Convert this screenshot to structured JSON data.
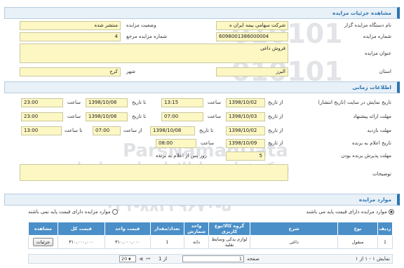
{
  "header": {
    "title": "مشاهده جزئیات مزایده"
  },
  "auction": {
    "org_label": "نام دستگاه مزایده گزار",
    "org_value": "شرکت سهامی بیمه ایران ه",
    "status_label": "وضعیت مزایده",
    "status_value": "منتشر شده",
    "number_label": "شماره مزایده",
    "number_value": "6098001386000004",
    "ref_label": "شماره مزایده مرجع",
    "ref_value": "4",
    "subject_label": "عنوان مزایده",
    "subject_value": "فروش داغی",
    "province_label": "استان",
    "province_value": "البرز",
    "city_label": "شهر",
    "city_value": "کرج"
  },
  "timing": {
    "title": "اطلاعات زمانی",
    "display": {
      "label": "تاریخ نمایش در سایت (تاریخ انتشار)",
      "from_label": "از تاریخ",
      "from_date": "1398/10/02",
      "time_label": "ساعت",
      "from_time": "13:15",
      "to_label": "تا تاریخ",
      "to_date": "1398/10/08",
      "to_time": "23:00"
    },
    "offer": {
      "label": "مهلت ارائه پیشنهاد",
      "from_label": "از تاریخ",
      "from_date": "1398/10/03",
      "time_label": "ساعت",
      "from_time": "07:00",
      "to_label": "تا تاریخ",
      "to_date": "1398/10/08",
      "to_time": "23:00"
    },
    "visit": {
      "label": "مهلت بازدید",
      "from_label": "از تاریخ",
      "from_date": "1398/10/02",
      "to_label": "تا تاریخ",
      "to_date": "1398/10/08",
      "from_time_label": "از ساعت",
      "from_time": "07:00",
      "to_time_label": "تا ساعت",
      "to_time": "13:00"
    },
    "winner": {
      "label": "تاریخ اعلام به برنده",
      "date_label": "از تاریخ",
      "date": "1398/10/09",
      "time_label": "ساعت",
      "time": "08:00"
    },
    "accept": {
      "label": "مهلت پذیرش برنده بودن",
      "value": "5",
      "suffix": "روز پس از اعلام به برنده"
    },
    "notes_label": "توضیحات"
  },
  "items": {
    "title": "موارد مزایده",
    "radio1": "موارد مزایده دارای قیمت پایه می باشند",
    "radio2": "موارد مزایده دارای قیمت پایه نمی باشند",
    "columns": [
      "ردیف",
      "نوع",
      "شرح",
      "گروه کالا/نوع کاربری",
      "واحد شمارش",
      "تعداد/مقدار",
      "قیمت واحد",
      "قیمت کل",
      "مشاهده"
    ],
    "rows": [
      {
        "row": "1",
        "type": "منقول",
        "desc": "داغی",
        "group": "لوازم یدکی وسایط نقلیه",
        "unit": "دانه",
        "qty": "1",
        "unit_price": "۳۱۰,۰۰۰,۰۰۰",
        "total": "۳۱۰,۰۰۰,۰۰۰",
        "action": "جزئیات"
      }
    ]
  },
  "pager": {
    "page_label": "صفحه",
    "page": "1",
    "of_label": "از 1",
    "page_size": "20",
    "summary": "نمایش ۱ - ۱ از ۱"
  },
  "watermark": {
    "line1": "مرکز فراوری اطلاعات پارس ناد داده",
    "line2": "۰۲۱-۸۸۳۴۹۶۷۰-۵",
    "logo": "ParsNamadData",
    "digits": "010101"
  },
  "colors": {
    "accent": "#2d74b0",
    "field_bg": "#fdf7c3",
    "section_bg": "#e8f0f8",
    "table_header": "#4a8fc8"
  }
}
